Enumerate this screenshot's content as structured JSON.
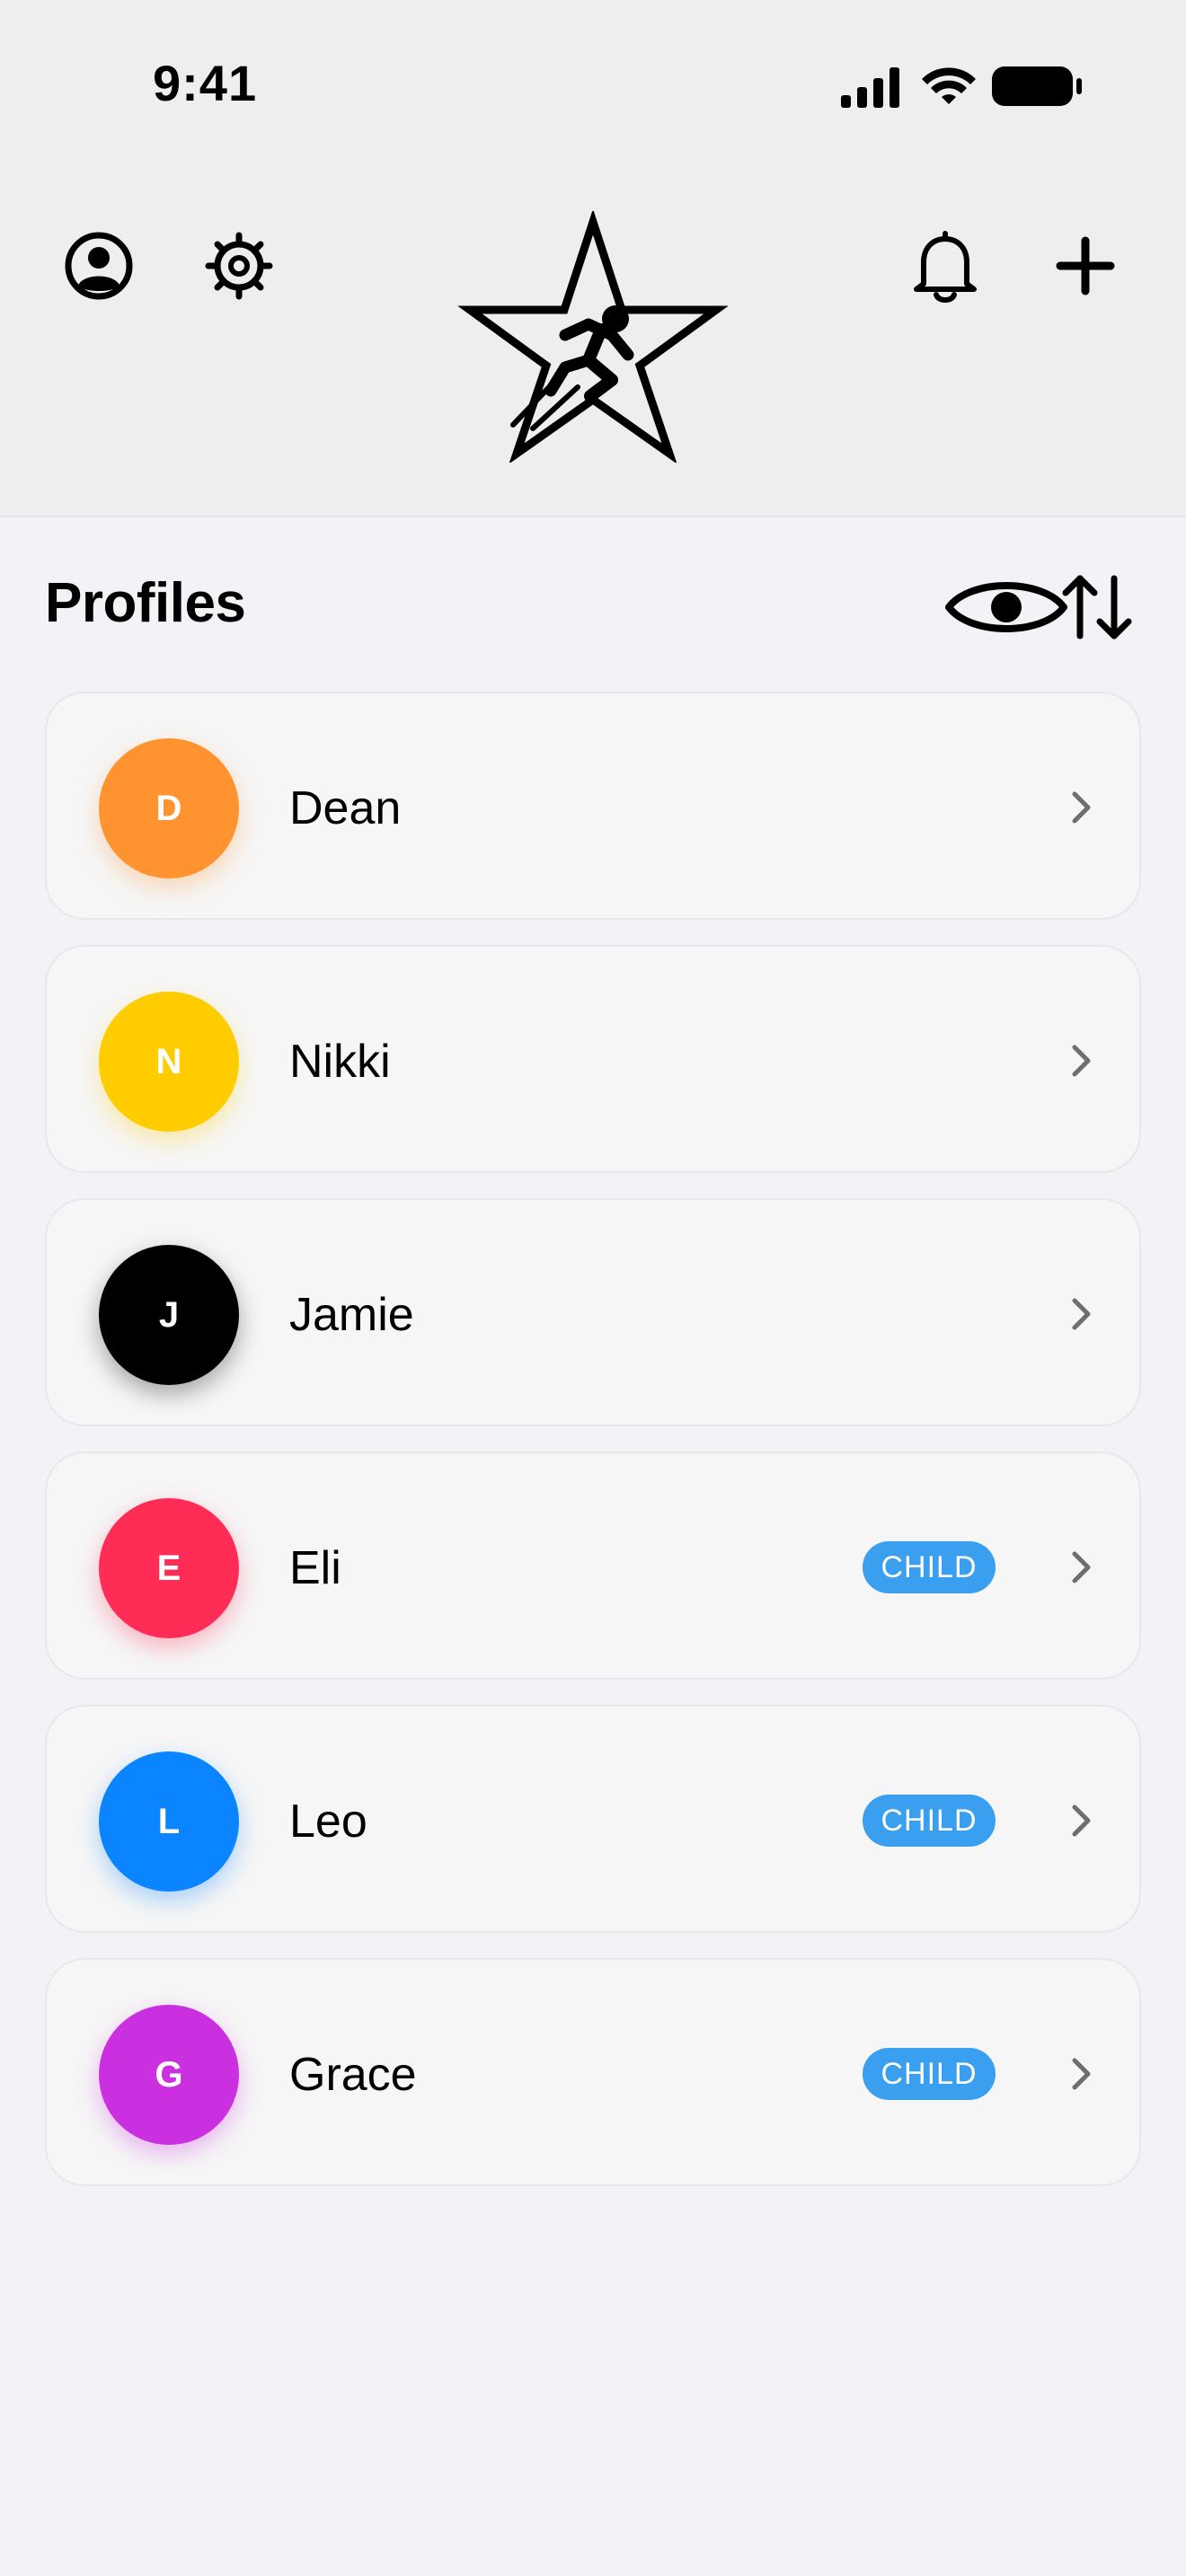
{
  "status_bar": {
    "time": "9:41",
    "icons": [
      "cellular-signal-icon",
      "wifi-icon",
      "battery-icon"
    ]
  },
  "header": {
    "left_icons": [
      "profile-icon",
      "settings-gear-icon"
    ],
    "logo": "running-star-logo",
    "right_icons": [
      "notification-bell-icon",
      "add-plus-icon"
    ]
  },
  "section": {
    "title": "Profiles",
    "tools": [
      "visibility-eye-icon",
      "sort-arrows-icon"
    ]
  },
  "profiles": [
    {
      "initial": "D",
      "name": "Dean",
      "color": "#ff9330",
      "badge": ""
    },
    {
      "initial": "N",
      "name": "Nikki",
      "color": "#ffcc00",
      "badge": ""
    },
    {
      "initial": "J",
      "name": "Jamie",
      "color": "#000000",
      "badge": ""
    },
    {
      "initial": "E",
      "name": "Eli",
      "color": "#ff2d55",
      "badge": "CHILD"
    },
    {
      "initial": "L",
      "name": "Leo",
      "color": "#0a84ff",
      "badge": "CHILD"
    },
    {
      "initial": "G",
      "name": "Grace",
      "color": "#cb30e0",
      "badge": "CHILD"
    }
  ],
  "colors": {
    "badge": "#3a9fef",
    "background": "#f2f2f7",
    "card": "#f6f6f6"
  }
}
